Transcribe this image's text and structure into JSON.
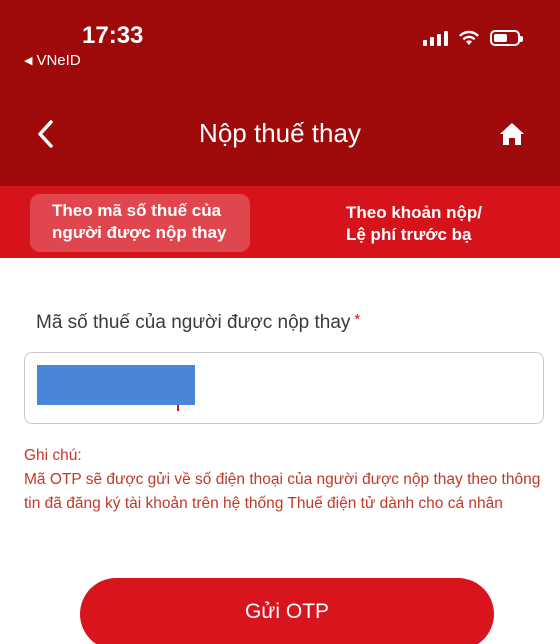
{
  "status_bar": {
    "time": "17:33",
    "back_app_label": "VNeID"
  },
  "header": {
    "title": "Nộp thuế thay",
    "color": "#9e0a0a"
  },
  "tabs": [
    {
      "line1": "Theo mã số thuế của",
      "line2": "người được nộp thay",
      "active": true
    },
    {
      "line1": "Theo khoản nộp/",
      "line2": "Lệ phí trước bạ",
      "active": false
    }
  ],
  "form": {
    "label": "Mã số thuế của người được nộp thay",
    "required_mark": "*"
  },
  "note": {
    "title": "Ghi chú:",
    "text": "Mã OTP sẽ được gửi về số điện thoại của người được nộp thay theo thông tin đã đăng ký tài khoản trên hệ thống Thuế điện tử dành cho cá nhân"
  },
  "submit_button": {
    "label": "Gửi OTP",
    "color": "#d8151d"
  },
  "icons": {
    "back": "chevron-left-icon",
    "home": "home-icon"
  }
}
